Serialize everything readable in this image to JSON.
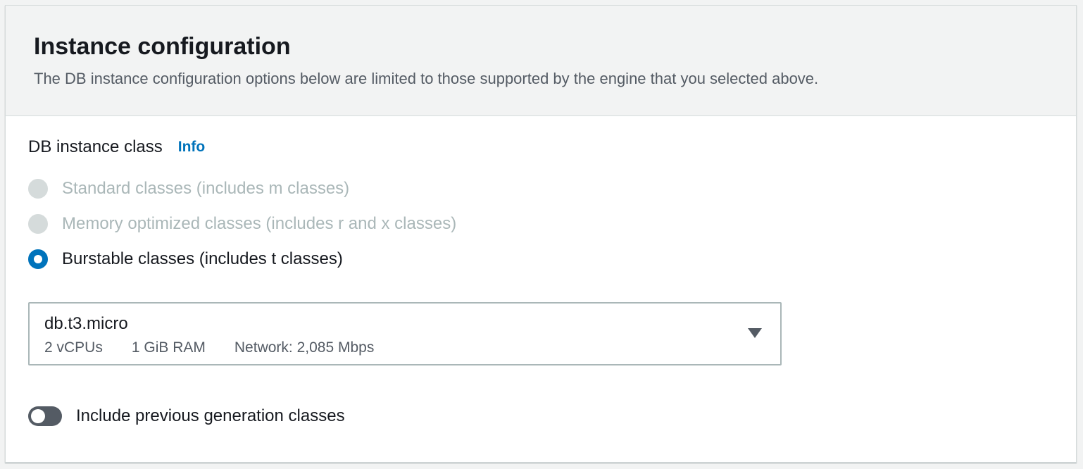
{
  "section": {
    "title": "Instance configuration",
    "description": "The DB instance configuration options below are limited to those supported by the engine that you selected above."
  },
  "instance_class": {
    "label": "DB instance class",
    "info_link": "Info",
    "options": [
      {
        "label": "Standard classes (includes m classes)",
        "disabled": true,
        "selected": false
      },
      {
        "label": "Memory optimized classes (includes r and x classes)",
        "disabled": true,
        "selected": false
      },
      {
        "label": "Burstable classes (includes t classes)",
        "disabled": false,
        "selected": true
      }
    ]
  },
  "instance_select": {
    "value": "db.t3.micro",
    "vcpus": "2 vCPUs",
    "ram": "1 GiB RAM",
    "network": "Network: 2,085 Mbps",
    "icon": "caret-down-icon"
  },
  "previous_generation_toggle": {
    "label": "Include previous generation classes",
    "checked": false
  },
  "colors": {
    "accent": "#0073bb",
    "header_bg": "#f2f3f3",
    "disabled": "#aab7b8",
    "text": "#16191f"
  }
}
